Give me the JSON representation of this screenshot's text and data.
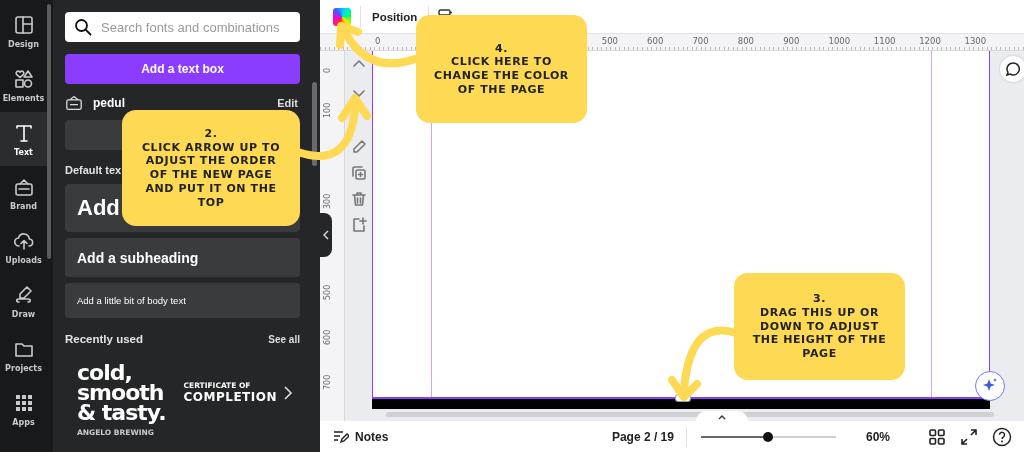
{
  "rail": {
    "items": [
      {
        "label": "Design",
        "selected": false
      },
      {
        "label": "Elements",
        "selected": false
      },
      {
        "label": "Text",
        "selected": true
      },
      {
        "label": "Brand",
        "selected": false
      },
      {
        "label": "Uploads",
        "selected": false
      },
      {
        "label": "Draw",
        "selected": false
      },
      {
        "label": "Projects",
        "selected": false
      },
      {
        "label": "Apps",
        "selected": false
      }
    ]
  },
  "panel": {
    "search": {
      "placeholder": "Search fonts and combinations"
    },
    "add_button": "Add a text box",
    "brand_kit": {
      "name": "pedul",
      "action": "Edit"
    },
    "section_title": "Default tex",
    "styles": [
      {
        "kind": "heading",
        "text": "Add"
      },
      {
        "kind": "subheading",
        "text": "Add a subheading"
      },
      {
        "kind": "body",
        "text": "Add a little bit of body text"
      }
    ],
    "recent": {
      "title": "Recently used",
      "action": "See all",
      "tiles": [
        {
          "kind": "poster",
          "lines": [
            "cold,",
            "smooth",
            "& tasty."
          ],
          "caption": "ANGELO BREWING"
        },
        {
          "kind": "certificate",
          "small": "CERTIFICATE OF",
          "large": "COMPLETION"
        }
      ]
    }
  },
  "toolbar": {
    "position": "Position"
  },
  "ruler": {
    "x_labels": [
      "0",
      "500",
      "600",
      "700",
      "800",
      "900",
      "1000",
      "1100",
      "1200",
      "1300"
    ],
    "y_labels": [
      "0",
      "100",
      "300",
      "500",
      "600",
      "700"
    ]
  },
  "callouts": [
    {
      "number": "2.",
      "text": "CLICK ARROW UP TO ADJUST THE ORDER OF THE NEW PAGE AND PUT IT ON THE TOP"
    },
    {
      "number": "4.",
      "text": "CLICK HERE TO CHANGE THE COLOR OF THE PAGE"
    },
    {
      "number": "3.",
      "text": "DRAG THIS UP OR DOWN TO ADJUST THE HEIGHT OF THE PAGE"
    }
  ],
  "bottom_bar": {
    "notes": "Notes",
    "page": "Page 2 / 19",
    "zoom": {
      "level": 0.5
    },
    "zoom_reading": "60%"
  }
}
